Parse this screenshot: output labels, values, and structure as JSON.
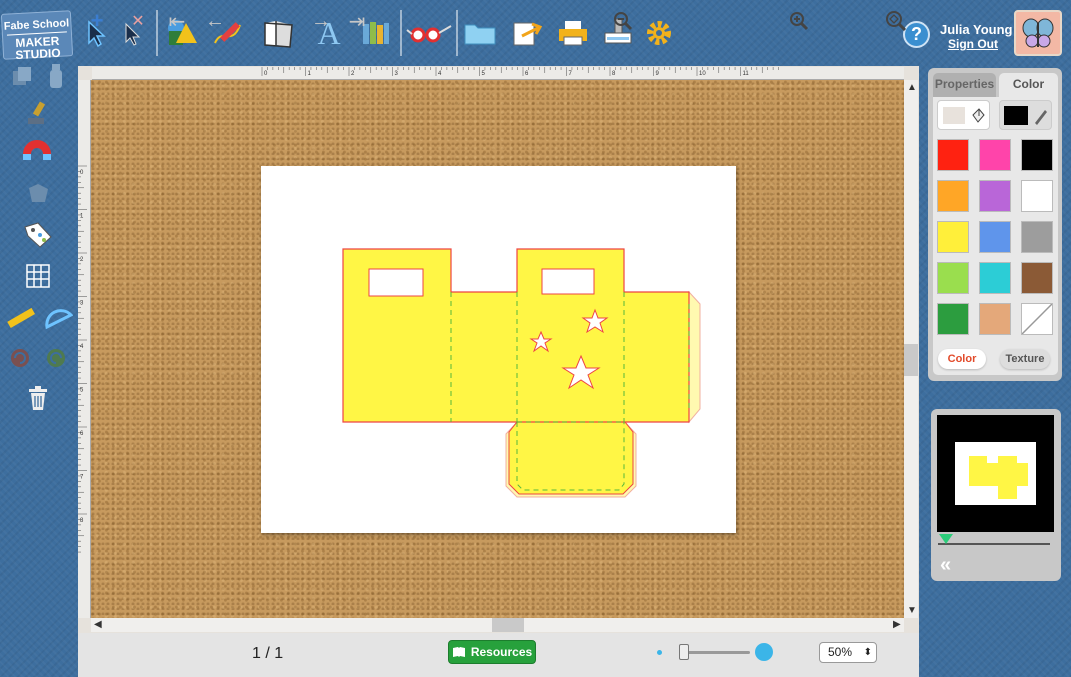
{
  "app": {
    "logo_line1": "Fabe School",
    "logo_line2": "MAKER STUDIO"
  },
  "toolbar": {
    "tools": [
      {
        "name": "select-arrow-icon"
      },
      {
        "name": "direct-select-icon"
      },
      {
        "name": "shapes-icon"
      },
      {
        "name": "pencil-icon"
      },
      {
        "name": "paper-fold-icon"
      },
      {
        "name": "text-icon"
      },
      {
        "name": "library-books-icon"
      },
      {
        "name": "3d-glasses-icon"
      },
      {
        "name": "folder-icon"
      },
      {
        "name": "export-icon"
      },
      {
        "name": "printer-icon"
      },
      {
        "name": "cutter-icon"
      },
      {
        "name": "gear-icon"
      }
    ]
  },
  "user": {
    "help": "?",
    "name": "Julia Young",
    "sign_out": "Sign Out"
  },
  "ruler": {
    "top_ticks": [
      "0",
      "1",
      "2",
      "3",
      "4",
      "5",
      "6",
      "7",
      "8",
      "9",
      "10",
      "11"
    ],
    "left_ticks": [
      "0",
      "1",
      "2",
      "3",
      "4",
      "5",
      "6",
      "7",
      "8"
    ]
  },
  "bottom_bar": {
    "page_indicator": "1 / 1",
    "resources_label": "Resources",
    "zoom_value": "50%",
    "zoom_fraction": 0.05
  },
  "properties_panel": {
    "tab_properties": "Properties",
    "tab_color": "Color",
    "active_tab": "Color",
    "fill_color": "#e8e2dc",
    "stroke_color": "#000000",
    "swatches": [
      "#ff2211",
      "#ff44aa",
      "#000000",
      "#ffa626",
      "#b966d8",
      "#ffffff",
      "#ffef3a",
      "#5f95eb",
      "#9d9d9d",
      "#9ade4e",
      "#2ccdd6",
      "#8b5a36",
      "#2c9d3f",
      "#e4a87a",
      "none"
    ],
    "btn_color": "Color",
    "btn_texture": "Texture"
  },
  "design": {
    "fill": "#fff645",
    "outline": "#ee4444",
    "fold": "#56b83a"
  }
}
